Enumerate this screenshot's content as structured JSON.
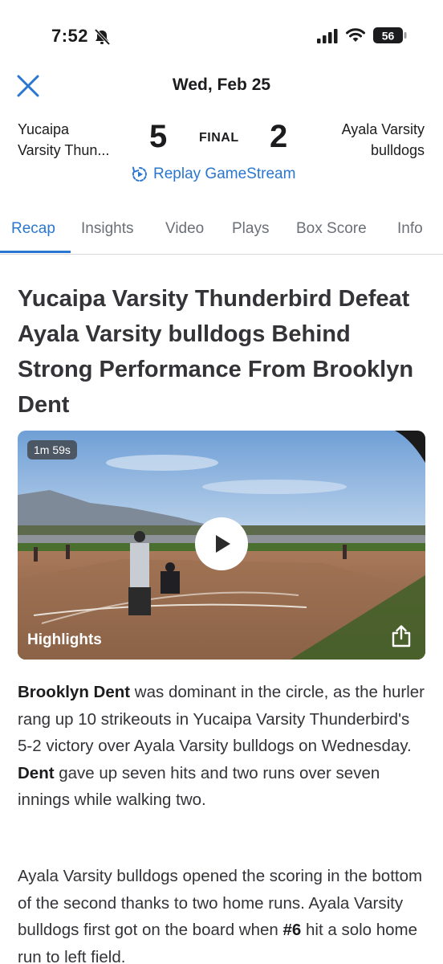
{
  "status_bar": {
    "time": "7:52",
    "battery": "56"
  },
  "header": {
    "date": "Wed, Feb 25"
  },
  "game": {
    "home_team_line1": "Yucaipa",
    "home_team_line2": "Varsity Thun...",
    "home_score": "5",
    "status": "FINAL",
    "away_score": "2",
    "away_team_line1": "Ayala Varsity",
    "away_team_line2": "bulldogs",
    "replay_label": "Replay GameStream"
  },
  "tabs": [
    {
      "label": "Recap",
      "active": true
    },
    {
      "label": "Insights"
    },
    {
      "label": "Video"
    },
    {
      "label": "Plays"
    },
    {
      "label": "Box Score"
    },
    {
      "label": "Info"
    }
  ],
  "article": {
    "headline": "Yucaipa Varsity Thunderbird Defeat Ayala Varsity bulldogs Behind Strong Performance From Brooklyn Dent",
    "video": {
      "duration": "1m 59s",
      "title": "Highlights"
    },
    "p1": {
      "name": "Brooklyn Dent",
      "text1": " was dominant in the circle, as the hurler rang up 10 strikeouts in Yucaipa Varsity Thunderbird's 5-2 victory over Ayala Varsity bulldogs on Wednesday. ",
      "bold2": "Dent",
      "text2": " gave up seven hits and two runs over seven innings while walking two."
    },
    "p2": {
      "text1": "Ayala Varsity bulldogs opened the scoring in the bottom of the second thanks to two home runs. Ayala Varsity bulldogs first got on the board when ",
      "bold": "#6",
      "text2": " hit a solo home run to left field."
    }
  },
  "colors": {
    "accent": "#2a77d0",
    "text": "#1c1c1e",
    "muted": "#6b6f76"
  }
}
